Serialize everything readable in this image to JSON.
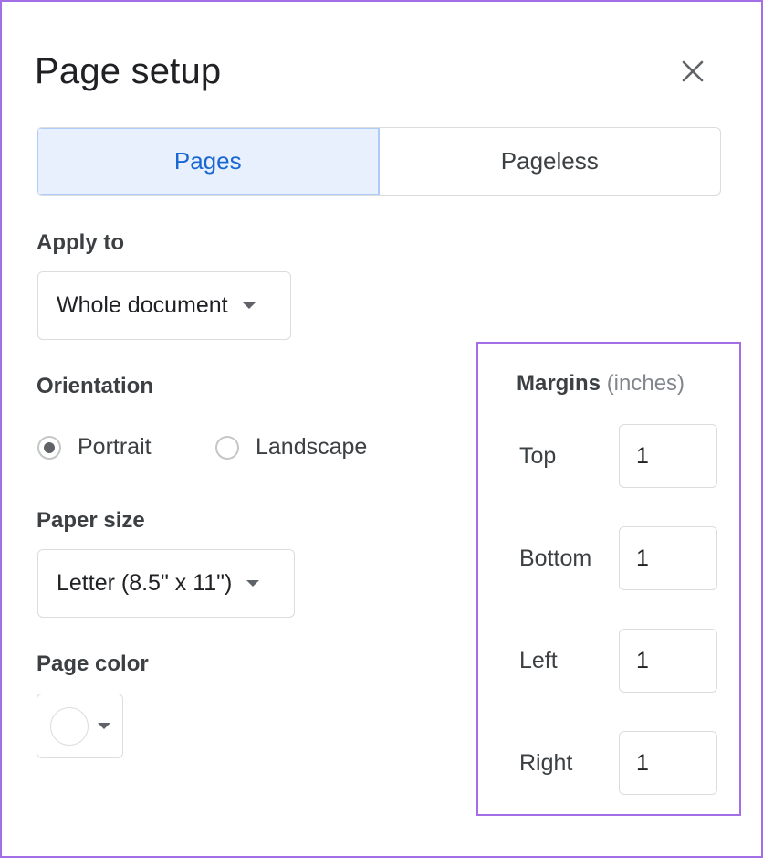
{
  "dialog": {
    "title": "Page setup",
    "close_icon": "close-icon"
  },
  "tabs": [
    {
      "label": "Pages",
      "active": true
    },
    {
      "label": "Pageless",
      "active": false
    }
  ],
  "apply_to": {
    "label": "Apply to",
    "value": "Whole document"
  },
  "orientation": {
    "label": "Orientation",
    "options": [
      {
        "label": "Portrait",
        "checked": true
      },
      {
        "label": "Landscape",
        "checked": false
      }
    ]
  },
  "paper_size": {
    "label": "Paper size",
    "value": "Letter (8.5\" x 11\")"
  },
  "page_color": {
    "label": "Page color",
    "color": "#ffffff"
  },
  "margins": {
    "title": "Margins",
    "unit": "(inches)",
    "fields": [
      {
        "label": "Top",
        "value": "1"
      },
      {
        "label": "Bottom",
        "value": "1"
      },
      {
        "label": "Left",
        "value": "1"
      },
      {
        "label": "Right",
        "value": "1"
      }
    ]
  },
  "colors": {
    "accent": "#1967d2",
    "active_tab_bg": "#e8f0fe",
    "highlight_border": "#a46ee6"
  }
}
